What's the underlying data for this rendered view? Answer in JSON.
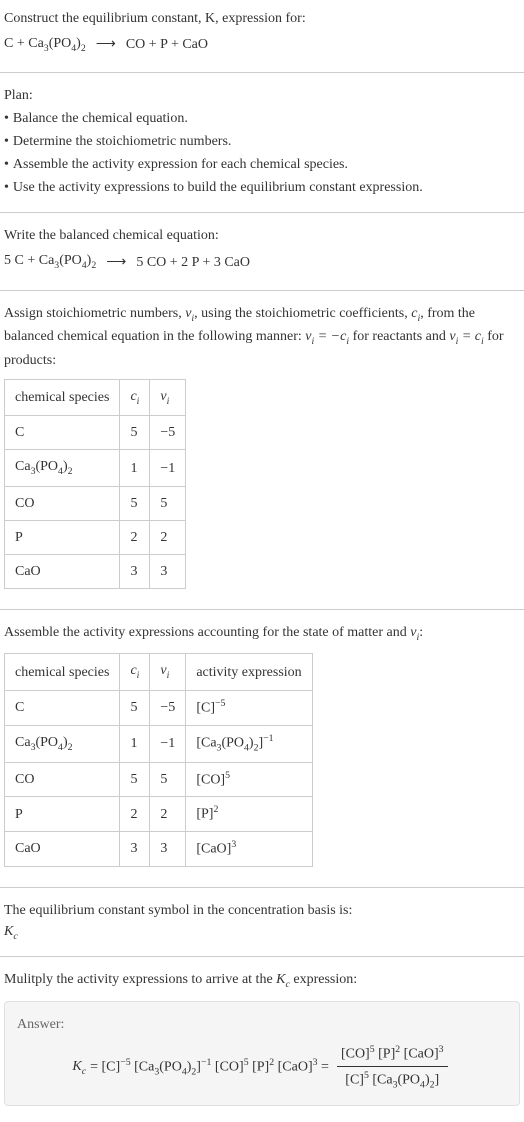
{
  "header": {
    "line1": "Construct the equilibrium constant, K, expression for:",
    "equation_left": "C + Ca₃(PO₄)₂",
    "equation_arrow": "⟶",
    "equation_right": "CO + P + CaO"
  },
  "plan": {
    "title": "Plan:",
    "items": [
      "Balance the chemical equation.",
      "Determine the stoichiometric numbers.",
      "Assemble the activity expression for each chemical species.",
      "Use the activity expressions to build the equilibrium constant expression."
    ]
  },
  "balanced": {
    "title": "Write the balanced chemical equation:",
    "equation_left": "5 C + Ca₃(PO₄)₂",
    "equation_arrow": "⟶",
    "equation_right": "5 CO + 2 P + 3 CaO"
  },
  "assign": {
    "text_part1": "Assign stoichiometric numbers, ",
    "nu_i": "νᵢ",
    "text_part2": ", using the stoichiometric coefficients, ",
    "c_i": "cᵢ",
    "text_part3": ", from the balanced chemical equation in the following manner: ",
    "rel1": "νᵢ = −cᵢ",
    "text_part4": " for reactants and ",
    "rel2": "νᵢ = cᵢ",
    "text_part5": " for products:"
  },
  "table1": {
    "headers": [
      "chemical species",
      "cᵢ",
      "νᵢ"
    ],
    "rows": [
      [
        "C",
        "5",
        "−5"
      ],
      [
        "Ca₃(PO₄)₂",
        "1",
        "−1"
      ],
      [
        "CO",
        "5",
        "5"
      ],
      [
        "P",
        "2",
        "2"
      ],
      [
        "CaO",
        "3",
        "3"
      ]
    ]
  },
  "assemble": {
    "text1": "Assemble the activity expressions accounting for the state of matter and ",
    "nu_i": "νᵢ",
    "text2": ":"
  },
  "table2": {
    "headers": [
      "chemical species",
      "cᵢ",
      "νᵢ",
      "activity expression"
    ],
    "rows": [
      {
        "species": "C",
        "ci": "5",
        "nui": "−5",
        "activity": "[C]⁻⁵"
      },
      {
        "species": "Ca₃(PO₄)₂",
        "ci": "1",
        "nui": "−1",
        "activity": "[Ca₃(PO₄)₂]⁻¹"
      },
      {
        "species": "CO",
        "ci": "5",
        "nui": "5",
        "activity": "[CO]⁵"
      },
      {
        "species": "P",
        "ci": "2",
        "nui": "2",
        "activity": "[P]²"
      },
      {
        "species": "CaO",
        "ci": "3",
        "nui": "3",
        "activity": "[CaO]³"
      }
    ]
  },
  "symbol": {
    "text": "The equilibrium constant symbol in the concentration basis is:",
    "kc": "K_c"
  },
  "multiply": {
    "text1": "Mulitply the activity expressions to arrive at the ",
    "kc": "K_c",
    "text2": " expression:"
  },
  "answer": {
    "label": "Answer:",
    "kc": "K_c",
    "equals": " = ",
    "expr": "[C]⁻⁵ [Ca₃(PO₄)₂]⁻¹ [CO]⁵ [P]² [CaO]³",
    "numerator": "[CO]⁵ [P]² [CaO]³",
    "denominator": "[C]⁵ [Ca₃(PO₄)₂]"
  }
}
